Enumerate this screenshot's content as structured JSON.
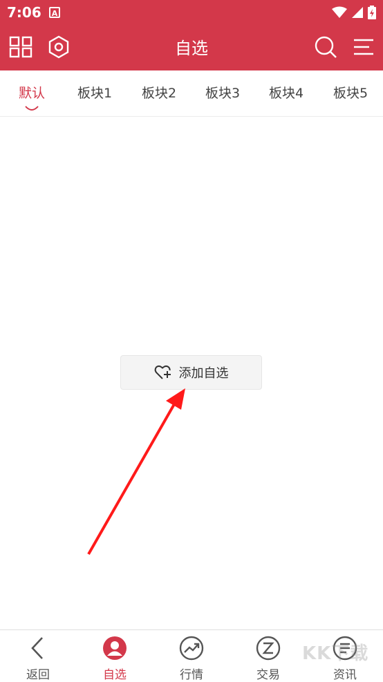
{
  "status_bar": {
    "time": "7:06",
    "app_badge": "A"
  },
  "header": {
    "title": "自选"
  },
  "tabs": [
    {
      "label": "默认",
      "active": true
    },
    {
      "label": "板块1",
      "active": false
    },
    {
      "label": "板块2",
      "active": false
    },
    {
      "label": "板块3",
      "active": false
    },
    {
      "label": "板块4",
      "active": false
    },
    {
      "label": "板块5",
      "active": false
    }
  ],
  "main": {
    "add_button_label": "添加自选"
  },
  "bottom_nav": [
    {
      "label": "返回",
      "icon": "back-icon"
    },
    {
      "label": "自选",
      "icon": "person-icon",
      "active": true
    },
    {
      "label": "行情",
      "icon": "trend-icon"
    },
    {
      "label": "交易",
      "icon": "exchange-icon"
    },
    {
      "label": "资讯",
      "icon": "news-icon"
    }
  ],
  "watermark": "KK下载",
  "colors": {
    "brand": "#d3384a",
    "arrow": "#ff1a1a"
  }
}
